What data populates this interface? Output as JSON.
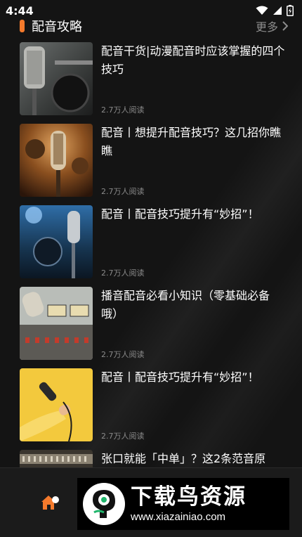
{
  "status_bar": {
    "time": "4:44"
  },
  "section": {
    "title": "配音攻略",
    "more_label": "更多"
  },
  "articles": [
    {
      "title": "配音干货|动漫配音时应该掌握的四个技巧",
      "reads": "2.7万人阅读"
    },
    {
      "title": "配音丨想提升配音技巧？这几招你瞧瞧",
      "reads": "2.7万人阅读"
    },
    {
      "title": "配音丨配音技巧提升有“妙招”！",
      "reads": "2.7万人阅读"
    },
    {
      "title": "播音配音必看小知识（零基础必备哦）",
      "reads": "2.7万人阅读"
    },
    {
      "title": "配音丨配音技巧提升有“妙招”！",
      "reads": "2.7万人阅读"
    },
    {
      "title": "张口就能「中单」？这2条范音原",
      "reads": ""
    }
  ],
  "watermark": {
    "name": "下载鸟资源",
    "url": "www.xiazainiao.com"
  },
  "colors": {
    "accent": "#f47a2c",
    "background": "#141414"
  }
}
